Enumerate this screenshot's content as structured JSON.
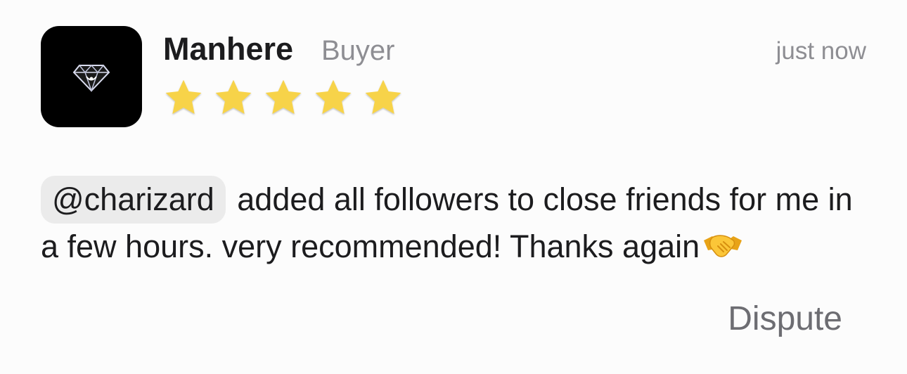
{
  "review": {
    "author": {
      "name": "Manhere",
      "role": "Buyer",
      "avatar_icon": "diamond-logo-icon"
    },
    "timestamp": "just now",
    "rating": 5,
    "mention": "@charizard",
    "text": " added all followers to close friends for me in a few hours. very recommended! Thanks again",
    "emoji_icon": "handshake-emoji-icon"
  },
  "actions": {
    "dispute_label": "Dispute"
  },
  "colors": {
    "star": "#f7d34a",
    "muted_text": "#8e8e93",
    "mention_bg": "#ebebeb",
    "avatar_bg": "#000000"
  }
}
